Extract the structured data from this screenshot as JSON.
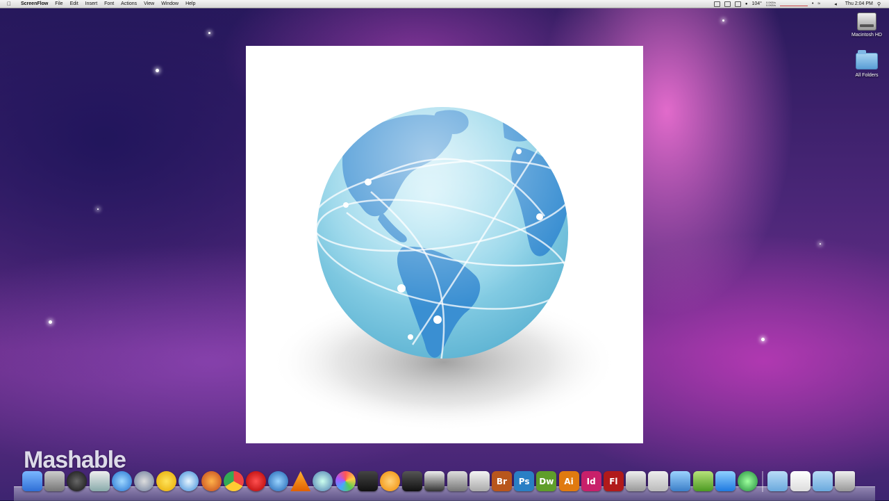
{
  "menubar": {
    "app_name": "ScreenFlow",
    "menus": [
      "File",
      "Edit",
      "Insert",
      "Font",
      "Actions",
      "View",
      "Window",
      "Help"
    ],
    "temperature": "104°",
    "net_up": "0.0KB/s",
    "net_down": "0.0KB/s",
    "clock": "Thu 2:04 PM"
  },
  "desktop_icons": [
    {
      "label": "Macintosh HD",
      "icon": "hard-drive-icon"
    },
    {
      "label": "All Folders",
      "icon": "folder-icon"
    }
  ],
  "watermark": "Mashable",
  "dock": {
    "apps": [
      {
        "name": "finder-icon",
        "label": ""
      },
      {
        "name": "system-preferences-icon",
        "label": ""
      },
      {
        "name": "dashboard-icon",
        "label": ""
      },
      {
        "name": "preview-icon",
        "label": ""
      },
      {
        "name": "itunes-icon",
        "label": ""
      },
      {
        "name": "dvd-player-icon",
        "label": ""
      },
      {
        "name": "adium-icon",
        "label": ""
      },
      {
        "name": "safari-icon",
        "label": ""
      },
      {
        "name": "firefox-icon",
        "label": ""
      },
      {
        "name": "chrome-icon",
        "label": ""
      },
      {
        "name": "opera-icon",
        "label": ""
      },
      {
        "name": "quicktime-icon",
        "label": ""
      },
      {
        "name": "vlc-icon",
        "label": ""
      },
      {
        "name": "iphoto-icon",
        "label": ""
      },
      {
        "name": "aperture-icon",
        "label": ""
      },
      {
        "name": "imovie-icon",
        "label": ""
      },
      {
        "name": "squeeze-icon",
        "label": ""
      },
      {
        "name": "final-cut-icon",
        "label": ""
      },
      {
        "name": "screenflow-icon",
        "label": ""
      },
      {
        "name": "photo-booth-icon",
        "label": ""
      },
      {
        "name": "screenshot-icon",
        "label": ""
      },
      {
        "name": "bridge-icon",
        "label": "Br"
      },
      {
        "name": "photoshop-icon",
        "label": "Ps"
      },
      {
        "name": "dreamweaver-icon",
        "label": "Dw"
      },
      {
        "name": "illustrator-icon",
        "label": "Ai"
      },
      {
        "name": "indesign-icon",
        "label": "Id"
      },
      {
        "name": "flash-icon",
        "label": "Fl"
      },
      {
        "name": "ipad-simulator-icon",
        "label": ""
      },
      {
        "name": "textwrangler-icon",
        "label": ""
      },
      {
        "name": "wordpress-icon",
        "label": ""
      },
      {
        "name": "network-icon",
        "label": ""
      },
      {
        "name": "dropbox-icon",
        "label": ""
      },
      {
        "name": "sync-icon",
        "label": ""
      }
    ],
    "folders": [
      {
        "name": "applications-folder-icon"
      },
      {
        "name": "documents-stack-icon"
      },
      {
        "name": "downloads-folder-icon"
      },
      {
        "name": "trash-icon"
      }
    ]
  },
  "colors": {
    "globe_ocean": "#8fd3e8",
    "globe_land": "#3a8fd2",
    "menubar": "#e6e6e6"
  }
}
